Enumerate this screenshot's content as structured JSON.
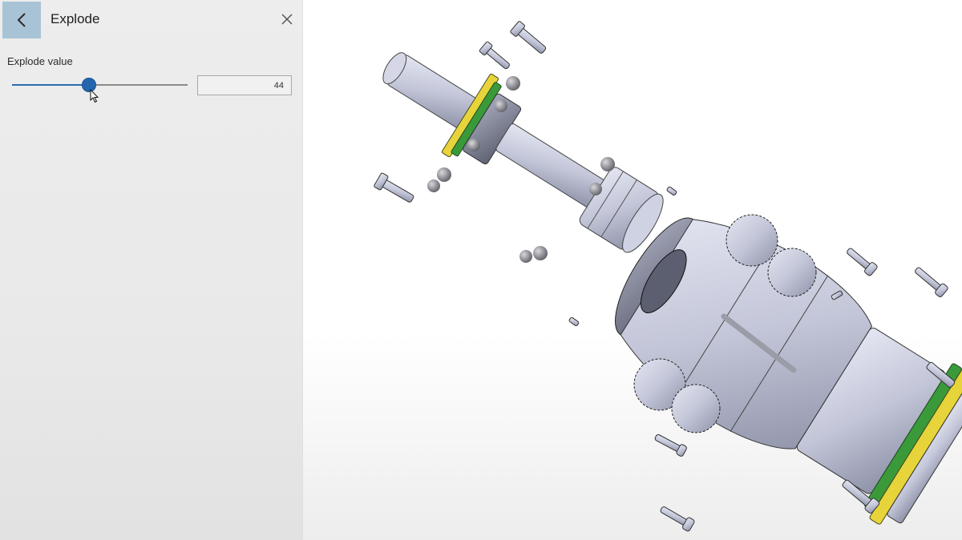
{
  "panel": {
    "title": "Explode",
    "back_icon": "chevron-left-icon",
    "close_icon": "close-icon",
    "explode": {
      "label": "Explode value",
      "value": "44",
      "slider_fraction": 0.44
    }
  },
  "colors": {
    "accent": "#2565ae",
    "back_button_bg": "#a9c3d6",
    "part_body": "#c9cbdc",
    "ring_yellow": "#e6d43a",
    "ring_green": "#3a9a3a"
  }
}
